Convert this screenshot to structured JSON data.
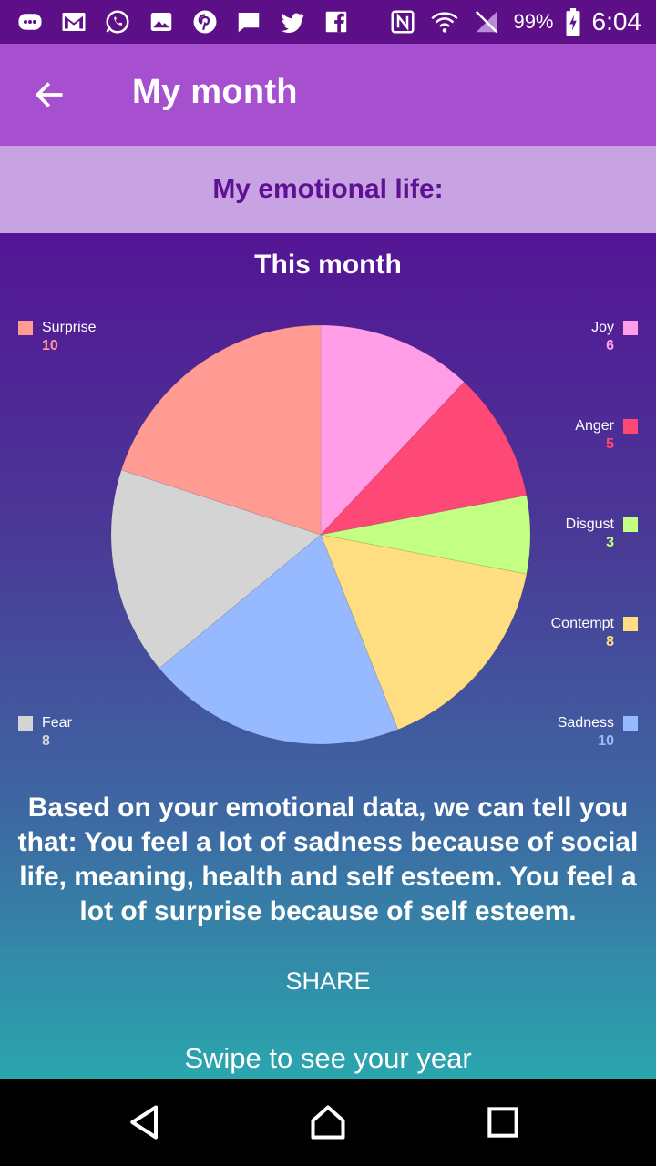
{
  "status_bar": {
    "battery": "99%",
    "time": "6:04",
    "icons": [
      "chat-bubble-icon",
      "gmail-icon",
      "whatsapp-icon",
      "gallery-icon",
      "pinterest-icon",
      "message-icon",
      "twitter-icon",
      "facebook-icon",
      "nfc-icon",
      "wifi-icon",
      "no-sim-icon",
      "battery-icon"
    ]
  },
  "appbar": {
    "title": "My month"
  },
  "section": {
    "title": "My emotional life:"
  },
  "chart_data": {
    "type": "pie",
    "title": "This month",
    "series": [
      {
        "name": "Joy",
        "value": 6,
        "color": "#ff9ee7"
      },
      {
        "name": "Anger",
        "value": 5,
        "color": "#fe4875"
      },
      {
        "name": "Disgust",
        "value": 3,
        "color": "#c2ff82"
      },
      {
        "name": "Contempt",
        "value": 8,
        "color": "#fede81"
      },
      {
        "name": "Sadness",
        "value": 10,
        "color": "#96b9ff"
      },
      {
        "name": "Fear",
        "value": 8,
        "color": "#d4d4d4"
      },
      {
        "name": "Surprise",
        "value": 10,
        "color": "#ff9b93"
      }
    ]
  },
  "legend": {
    "surprise": {
      "label": "Surprise",
      "value": "10"
    },
    "joy": {
      "label": "Joy",
      "value": "6"
    },
    "anger": {
      "label": "Anger",
      "value": "5"
    },
    "disgust": {
      "label": "Disgust",
      "value": "3"
    },
    "contempt": {
      "label": "Contempt",
      "value": "8"
    },
    "fear": {
      "label": "Fear",
      "value": "8"
    },
    "sadness": {
      "label": "Sadness",
      "value": "10"
    }
  },
  "analysis": "Based on your emotional data, we can tell you that: You feel a lot of sadness because of social life, meaning, health and self esteem. You feel a lot of surprise because of self esteem.",
  "actions": {
    "share": "SHARE",
    "swipe_hint": "Swipe to see your year"
  }
}
